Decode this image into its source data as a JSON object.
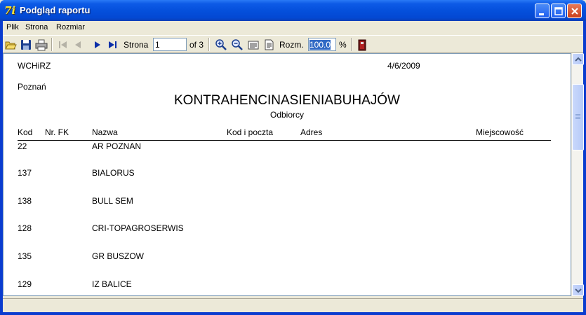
{
  "window": {
    "title": "Podgląd raportu"
  },
  "menu": [
    {
      "label": "Plik"
    },
    {
      "label": "Strona"
    },
    {
      "label": "Rozmiar"
    }
  ],
  "toolbar": {
    "page_label": "Strona",
    "page_value": "1",
    "page_of": "of 3",
    "zoom_label": "Rozm.",
    "zoom_value": "100.0",
    "zoom_unit": "%"
  },
  "report": {
    "org": "WCHiRZ",
    "date": "4/6/2009",
    "city": "Poznań",
    "title": "KONTRAHENCINASIENIABUHAJÓW",
    "subtitle": "Odbiorcy",
    "columns": [
      "Kod",
      "Nr. FK",
      "Nazwa",
      "Kod i poczta",
      "Adres",
      "Miejscowość"
    ],
    "rows": [
      {
        "kod": "22",
        "nazwa": "AR POZNAN"
      },
      {
        "kod": "137",
        "nazwa": "BIALORUS"
      },
      {
        "kod": "138",
        "nazwa": "BULL SEM"
      },
      {
        "kod": "128",
        "nazwa": "CRI-TOPAGROSERWIS"
      },
      {
        "kod": "135",
        "nazwa": "GR BUSZOW"
      },
      {
        "kod": "129",
        "nazwa": "IZ BALICE"
      }
    ]
  },
  "colors": {
    "titlebar": "#0550dc",
    "selection": "#316ac5"
  }
}
